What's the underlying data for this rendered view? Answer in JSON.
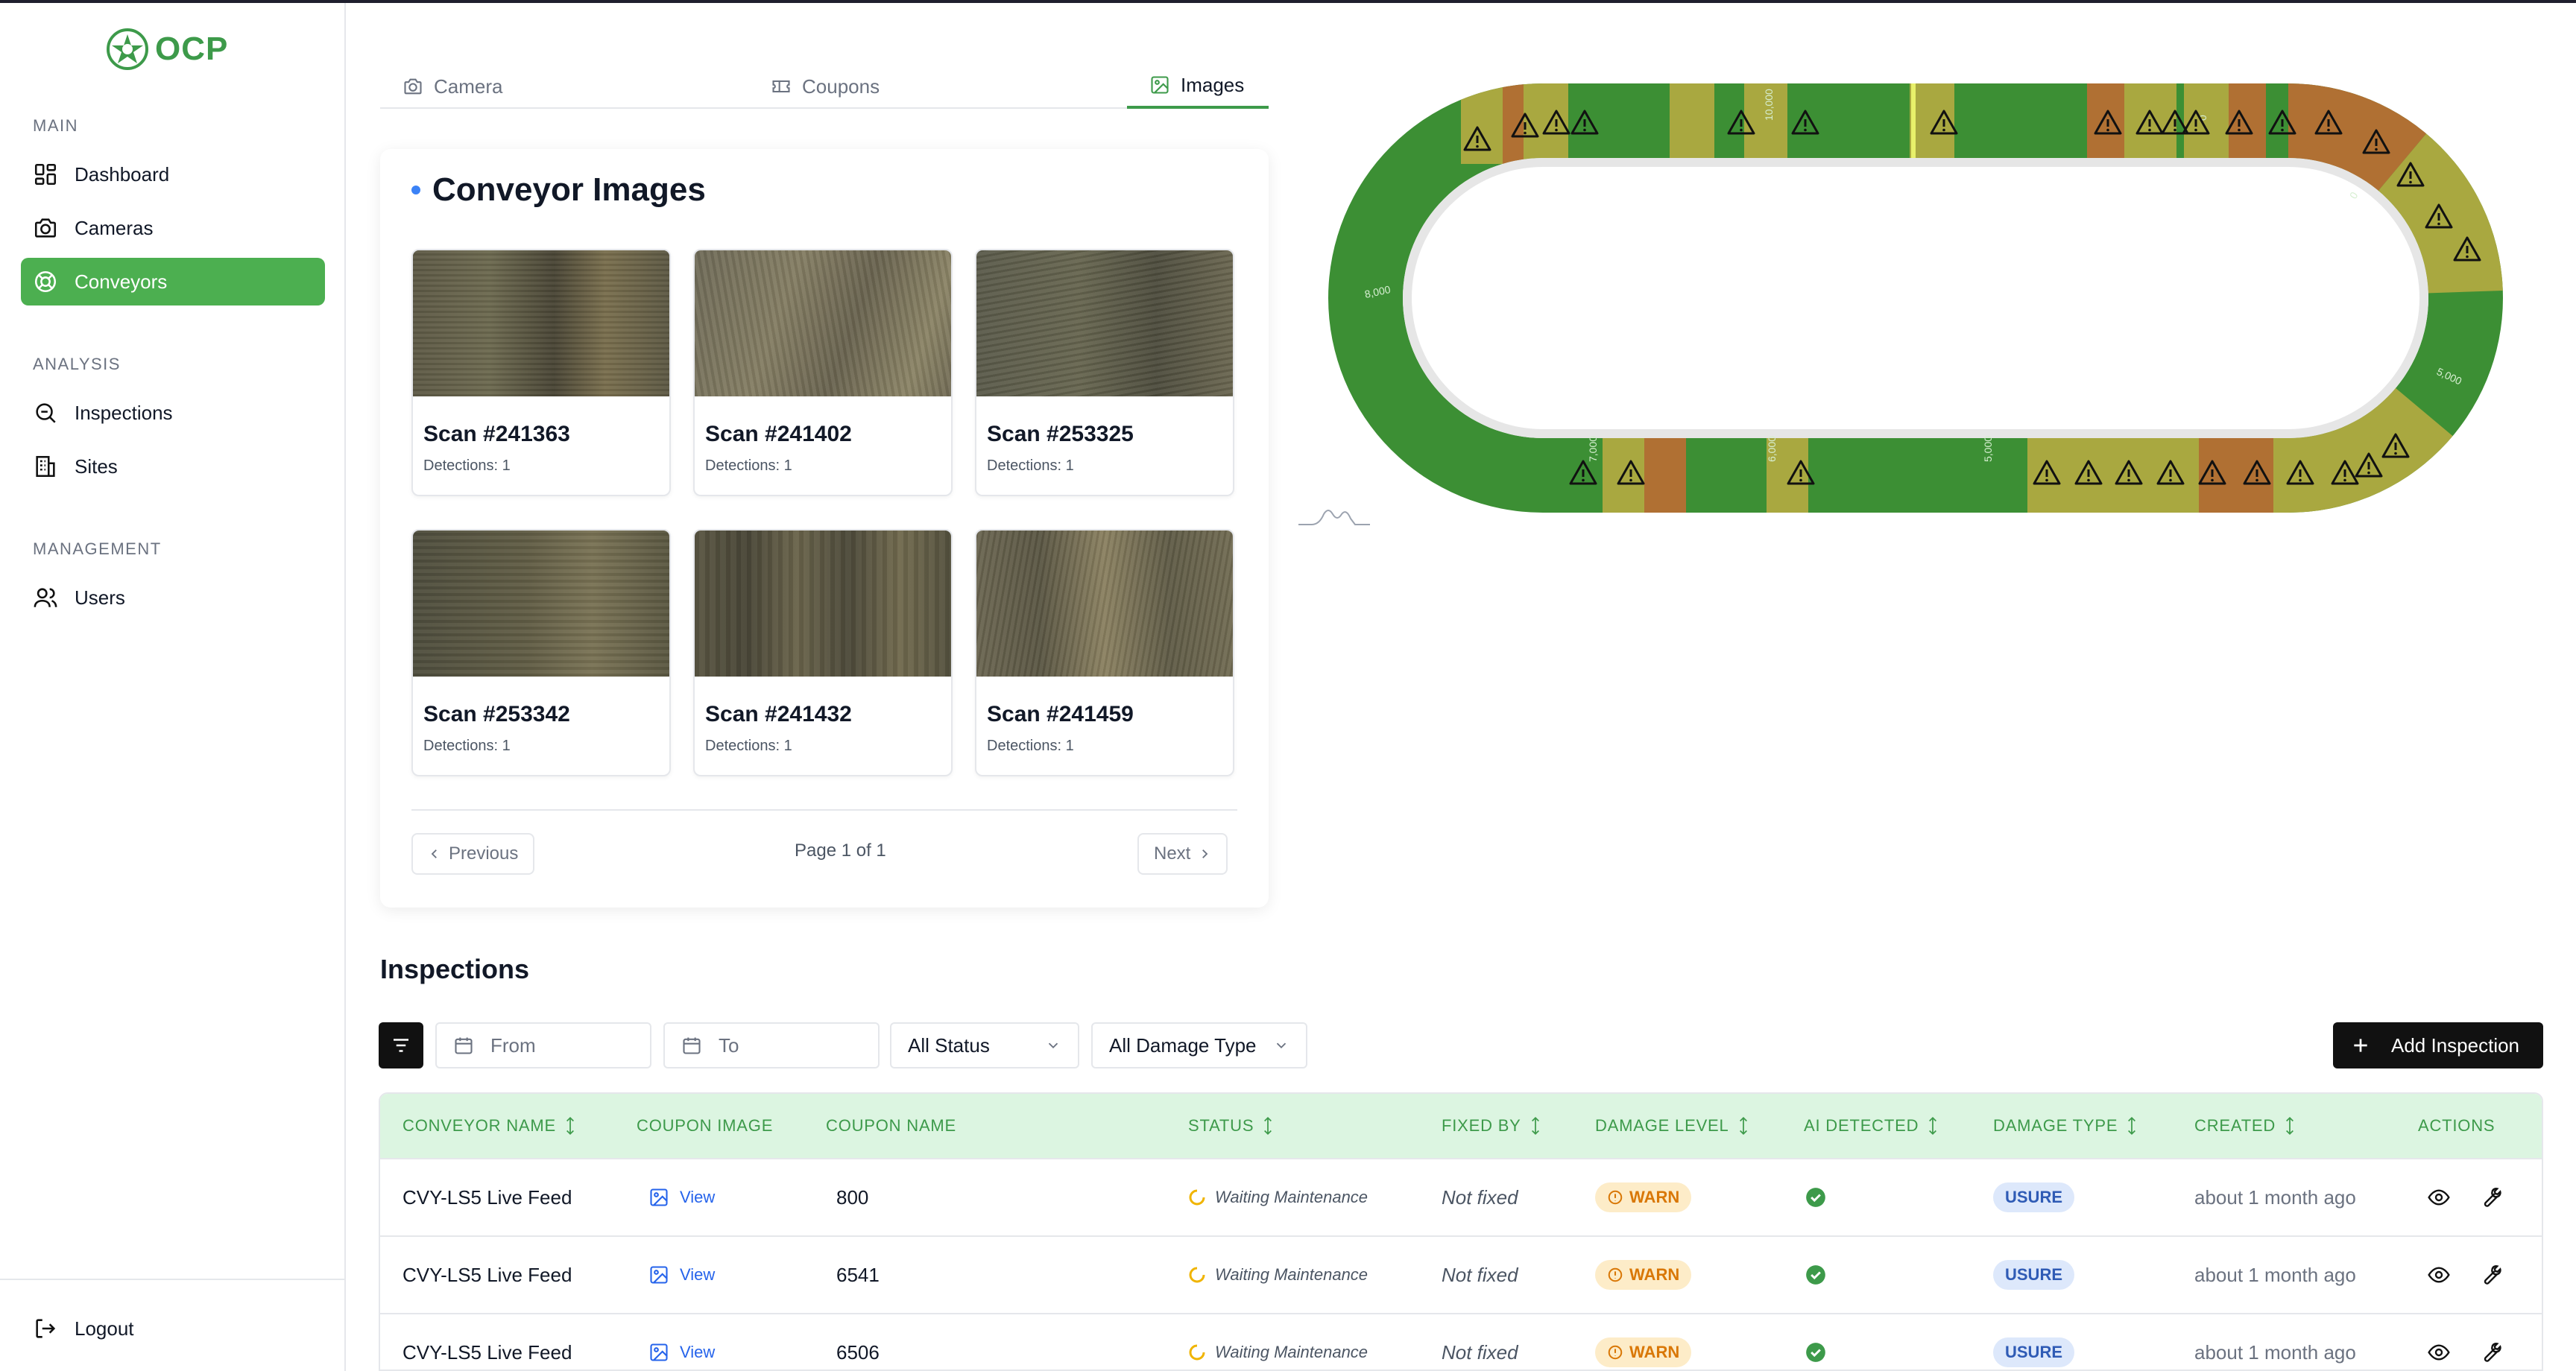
{
  "brand": {
    "name": "OCP",
    "color": "#3d9a4a"
  },
  "sidebar": {
    "sections": [
      {
        "label": "MAIN",
        "items": [
          {
            "label": "Dashboard",
            "icon": "grid-icon"
          },
          {
            "label": "Cameras",
            "icon": "camera-icon"
          },
          {
            "label": "Conveyors",
            "icon": "conveyor-icon",
            "active": true
          }
        ]
      },
      {
        "label": "ANALYSIS",
        "items": [
          {
            "label": "Inspections",
            "icon": "search-icon"
          },
          {
            "label": "Sites",
            "icon": "building-icon"
          }
        ]
      },
      {
        "label": "MANAGEMENT",
        "items": [
          {
            "label": "Users",
            "icon": "users-icon"
          }
        ]
      }
    ],
    "logout_label": "Logout"
  },
  "tabs": [
    {
      "label": "Camera",
      "icon": "camera-icon"
    },
    {
      "label": "Coupons",
      "icon": "ticket-icon"
    },
    {
      "label": "Images",
      "icon": "image-icon",
      "active": true
    }
  ],
  "images_card": {
    "title": "Conveyor Images",
    "scans": [
      {
        "name": "Scan #241363",
        "detections": "Detections: 1"
      },
      {
        "name": "Scan #241402",
        "detections": "Detections: 1"
      },
      {
        "name": "Scan #253325",
        "detections": "Detections: 1"
      },
      {
        "name": "Scan #253342",
        "detections": "Detections: 1"
      },
      {
        "name": "Scan #241432",
        "detections": "Detections: 1"
      },
      {
        "name": "Scan #241459",
        "detections": "Detections: 1"
      }
    ],
    "pagination": {
      "previous": "Previous",
      "info": "Page 1 of 1",
      "next": "Next"
    }
  },
  "track": {
    "distance_labels": [
      "8,000",
      "7,000",
      "6,000",
      "5,000",
      "10,000",
      "0",
      "0",
      "5,000"
    ],
    "colors": {
      "good": "#3c8f34",
      "warn": "#a9a840",
      "bad": "#b07033",
      "inner": "#e6e6e6"
    }
  },
  "inspections": {
    "title": "Inspections",
    "filters": {
      "from_placeholder": "From",
      "to_placeholder": "To",
      "status": "All Status",
      "damage_type": "All Damage Type"
    },
    "add_button": "Add Inspection",
    "columns": [
      "CONVEYOR NAME",
      "COUPON IMAGE",
      "COUPON NAME",
      "STATUS",
      "FIXED BY",
      "DAMAGE LEVEL",
      "AI DETECTED",
      "DAMAGE TYPE",
      "CREATED",
      "ACTIONS"
    ],
    "rows": [
      {
        "conveyor": "CVY-LS5 Live Feed",
        "image_link": "View",
        "coupon": "800",
        "status": "Waiting Maintenance",
        "fixed_by": "Not fixed",
        "damage_level": "WARN",
        "ai_detected": true,
        "damage_type": "USURE",
        "created": "about 1 month ago"
      },
      {
        "conveyor": "CVY-LS5 Live Feed",
        "image_link": "View",
        "coupon": "6541",
        "status": "Waiting Maintenance",
        "fixed_by": "Not fixed",
        "damage_level": "WARN",
        "ai_detected": true,
        "damage_type": "USURE",
        "created": "about 1 month ago"
      },
      {
        "conveyor": "CVY-LS5 Live Feed",
        "image_link": "View",
        "coupon": "6506",
        "status": "Waiting Maintenance",
        "fixed_by": "Not fixed",
        "damage_level": "WARN",
        "ai_detected": true,
        "damage_type": "USURE",
        "created": "about 1 month ago"
      }
    ]
  }
}
